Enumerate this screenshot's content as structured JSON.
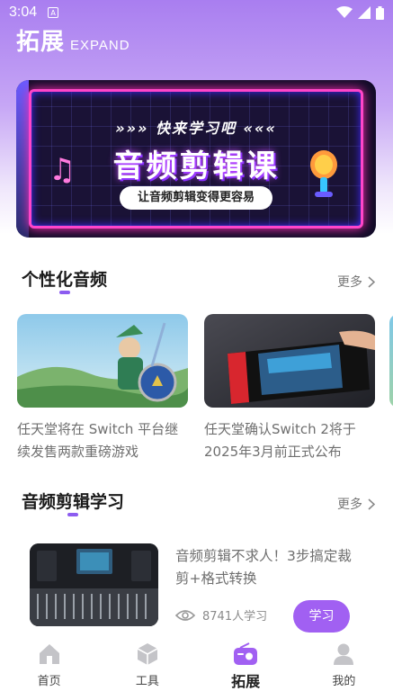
{
  "status_bar": {
    "time": "3:04",
    "notif_letter": "A"
  },
  "header": {
    "title": "拓展",
    "subtitle": "EXPAND"
  },
  "banner": {
    "line1": "»»» 快来学习吧 «««",
    "line2": "音频剪辑课",
    "tagline": "让音频剪辑变得更容易"
  },
  "personalized": {
    "title": "个性化音频",
    "more": "更多",
    "cards": [
      {
        "title": "任天堂将在 Switch 平台继续发售两款重磅游戏"
      },
      {
        "title": "任天堂确认Switch 2将于2025年3月前正式公布"
      }
    ]
  },
  "learning": {
    "title": "音频剪辑学习",
    "more": "更多",
    "item": {
      "title": "音频剪辑不求人！3步搞定裁剪+格式转换",
      "learners": "8741人学习",
      "button": "学习"
    }
  },
  "tabbar": {
    "tabs": [
      {
        "label": "首页",
        "icon": "home-icon"
      },
      {
        "label": "工具",
        "icon": "box-icon"
      },
      {
        "label": "拓展",
        "icon": "radio-icon",
        "active": true
      },
      {
        "label": "我的",
        "icon": "user-icon"
      }
    ]
  },
  "colors": {
    "accent": "#a160f2",
    "header_bg": "#a97ef0"
  }
}
